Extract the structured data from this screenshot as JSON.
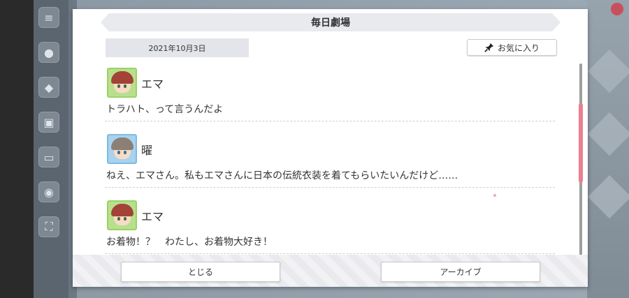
{
  "dialog": {
    "title": "毎日劇場",
    "date": "2021年10月3日",
    "favorite_label": "お気に入り"
  },
  "messages": [
    {
      "speaker": "エマ",
      "text": "トラハト、って言うんだよ",
      "avatar": "emma-avatar"
    },
    {
      "speaker": "曜",
      "text": "ねえ、エマさん。私もエマさんに日本の伝統衣装を着てもらいたいんだけど……",
      "avatar": "you-avatar"
    },
    {
      "speaker": "エマ",
      "text": "お着物！？　わたし、お着物大好き！",
      "avatar": "emma-avatar"
    }
  ],
  "footer": {
    "close_label": "とじる",
    "archive_label": "アーカイブ"
  },
  "colors": {
    "accent_scroll": "#e8808e",
    "header_bg": "#e9eaee",
    "avatar_green": "#b8e08c",
    "avatar_blue": "#a9d2ee"
  }
}
